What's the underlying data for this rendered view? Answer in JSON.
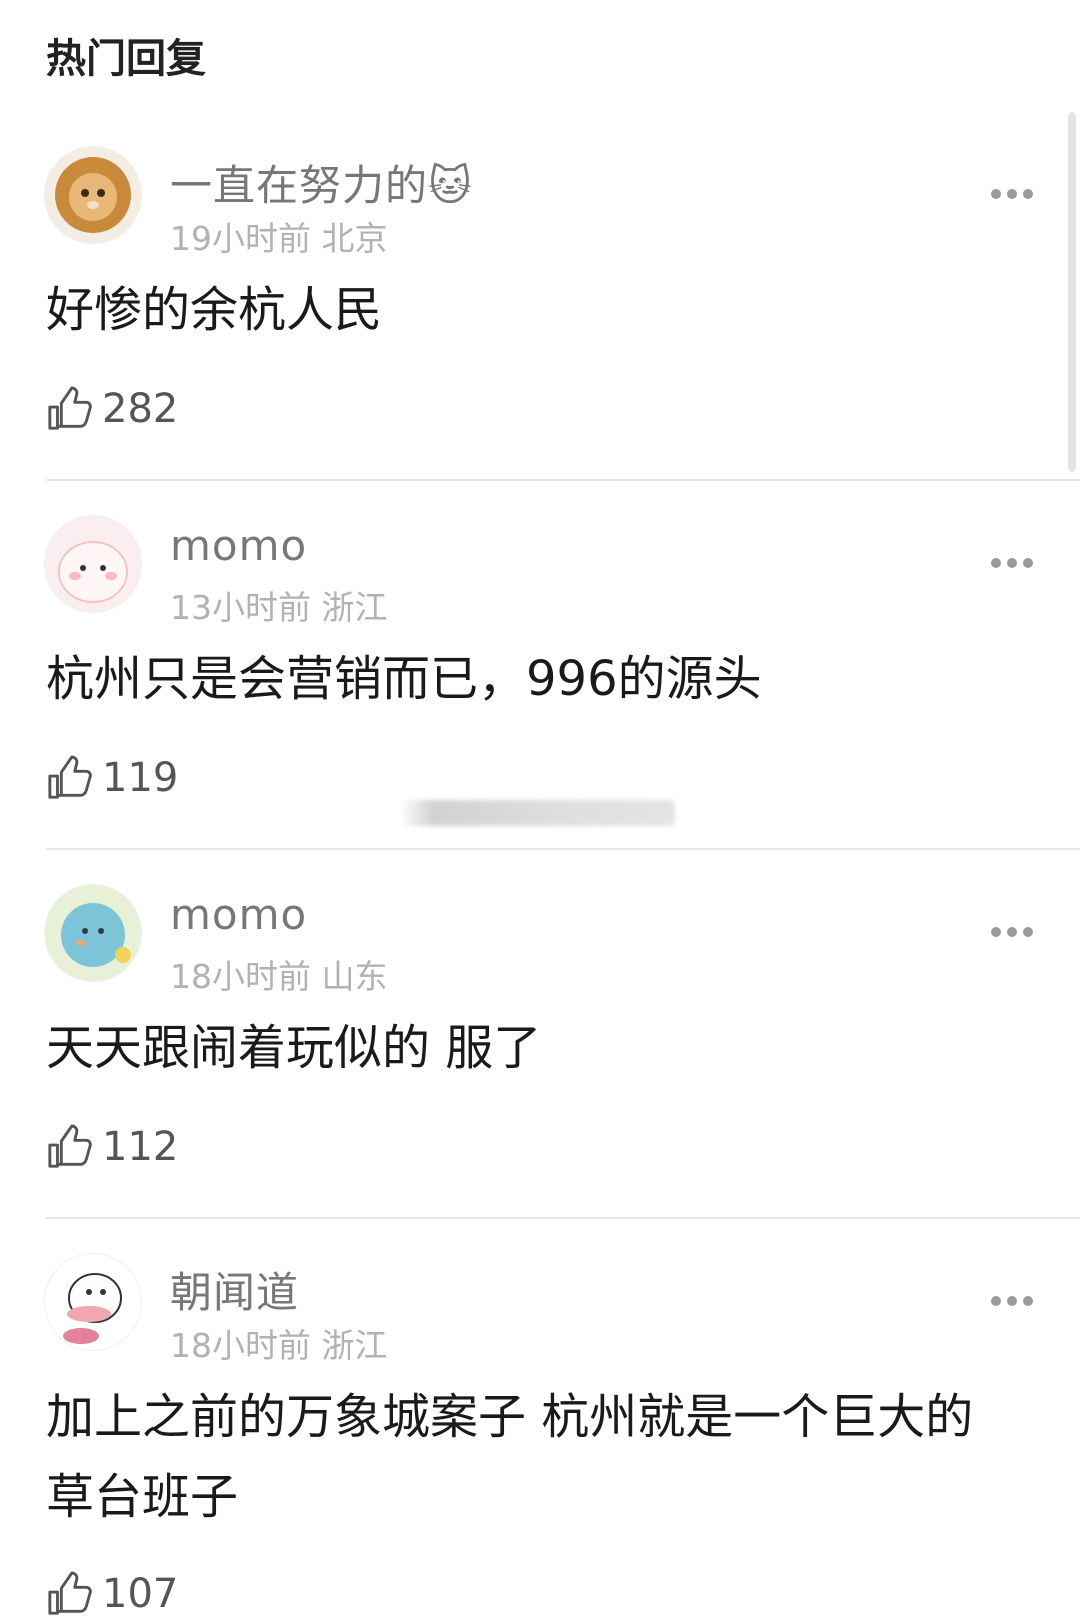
{
  "section_title": "热门回复",
  "comments": [
    {
      "username": "一直在努力的",
      "username_emoji": "🐱",
      "meta": "19小时前 北京",
      "text": "好惨的余杭人民",
      "likes": "282"
    },
    {
      "username": "momo",
      "meta": "13小时前 浙江",
      "text": "杭州只是会营销而已，996的源头",
      "likes": "119"
    },
    {
      "username": "momo",
      "meta": "18小时前 山东",
      "text": "天天跟闹着玩似的 服了",
      "likes": "112"
    },
    {
      "username": "朝闻道",
      "meta": "18小时前 浙江",
      "text": "加上之前的万象城案子 杭州就是一个巨大的草台班子",
      "likes": "107"
    }
  ],
  "icons": {
    "like": "thumbs-up-icon",
    "more": "more-dots-icon"
  },
  "colors": {
    "username": "#777777",
    "meta": "#b2b2b2",
    "text": "#1a1a1a",
    "divider": "#e6e6e6"
  }
}
